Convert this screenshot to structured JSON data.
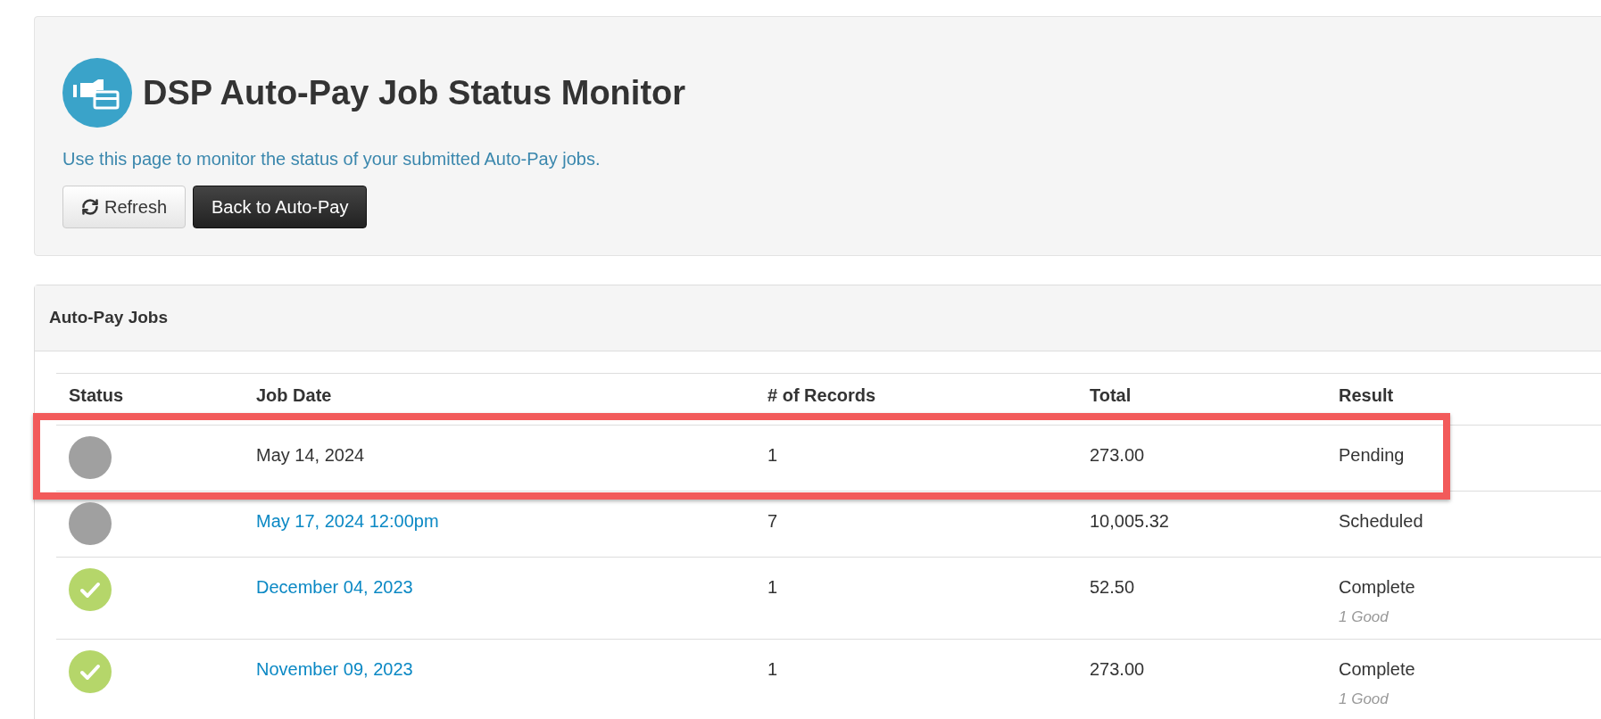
{
  "header": {
    "title": "DSP Auto-Pay Job Status Monitor",
    "description": "Use this page to monitor the status of your submitted Auto-Pay jobs.",
    "buttons": [
      {
        "label": "Refresh",
        "kind": "refresh"
      },
      {
        "label": "Back to Auto-Pay",
        "kind": "primary"
      }
    ]
  },
  "jobs_panel": {
    "title": "Auto-Pay Jobs",
    "table": {
      "columns": [
        "Status",
        "Job Date",
        "# of Records",
        "Total",
        "Result"
      ],
      "rows": [
        {
          "kind": "pending",
          "job_date": "May 14, 2024",
          "link": false,
          "records": "1",
          "total": "273.00",
          "result": "Pending",
          "highlighted": true
        },
        {
          "kind": "pending",
          "job_date": "May 17, 2024 12:00pm",
          "link": true,
          "records": "7",
          "total": "10,005.32",
          "result": "Scheduled",
          "highlighted": false
        },
        {
          "kind": "complete",
          "job_date": "December 04, 2023",
          "link": true,
          "records": "1",
          "total": "52.50",
          "result": "Complete",
          "note": "1 Good",
          "highlighted": false
        },
        {
          "kind": "complete",
          "job_date": "November 09, 2023",
          "link": true,
          "records": "1",
          "total": "273.00",
          "result": "Complete",
          "note": "1 Good",
          "highlighted": false
        }
      ]
    }
  }
}
